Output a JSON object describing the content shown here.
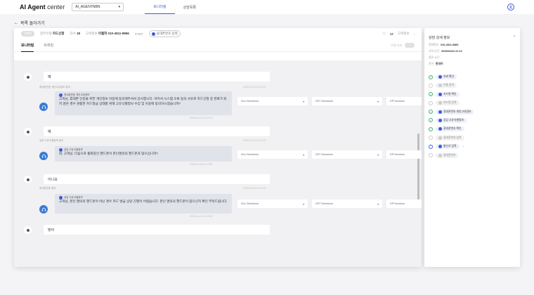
{
  "app": {
    "brand_bold": "AI Agent",
    "brand_thin": " center",
    "agent_value": "AI_AGENTNBN"
  },
  "nav": {
    "items": [
      {
        "label": "모니터링",
        "active": true
      },
      {
        "label": "상담목록",
        "active": false
      }
    ]
  },
  "back": {
    "label": "목록 돌아가기"
  },
  "info": {
    "status": "진행중",
    "type_label": "업무유형",
    "type_value": "카드신청",
    "turn_label": "차수",
    "turn_value": "18",
    "customer_label": "고객정보",
    "customer_name": "이철희",
    "customer_phone": "010-4511-9866",
    "step_label": "STEP",
    "step_value": "휴대폰번호 입력",
    "count": "17",
    "count_label": "고객정보"
  },
  "tabs": {
    "items": [
      {
        "label": "모니터링",
        "active": true
      },
      {
        "label": "트래킹",
        "active": false
      }
    ],
    "toggle_label": "모델 조회"
  },
  "dropdowns": {
    "nlu": "NLU Decisions",
    "dst": "DST Decisions",
    "dp": "DP Decision"
  },
  "messages": [
    {
      "user_text": "예",
      "user_ts": "2025-04-24 21:13:14",
      "sys_label": "휴대폰번호 개인고유정보 동의",
      "bot_tag": "휴대폰번호 개인고유정보",
      "bot_text": "고객님, 휴대폰 인증을 위한 개인정보 이용에 동의해주셔서 감사합니다. 이어서 시스템 오류 등의 사유로 카드신청 중 완료가 되지 않은 경우 원활한 카드발급 상태를 위해 고유식별정보 수집 및 이용에 동의하시겠습니까?",
      "bot_ts": "2025-04-24 21:13:14"
    },
    {
      "user_text": "예",
      "user_ts": "2025-04-24 21:13:24",
      "sys_label": "상담 고유식별정보 동의",
      "bot_tag": "상담 고유식별정보",
      "bot_text": "네, 고객님. 다음으로 통화중인 핸드폰이 본인명의의 핸드폰과 맞으십니까?",
      "bot_ts": "2025-04-24 21:13:34"
    },
    {
      "user_text": "아니요",
      "user_ts": "2025-04-24 21:13:40",
      "sys_label": "휴대폰번호 확인",
      "bot_tag": "상담 고유식별정보",
      "bot_text": "고객님, 본인 명의의 핸드폰이 아닌 경우 카드 발급 상담 진행이 어렵습니다. 본인 명의의 핸드폰이 맞으신지 확인 부탁드립니다.",
      "bot_ts": "2025-04-24 21:13:52"
    },
    {
      "user_text": "맞아"
    }
  ],
  "side": {
    "title": "상담 상세 정보",
    "phone_label": "전화번호",
    "phone_value": "010-4511-9866",
    "start_label": "시작 시간",
    "start_value": "2025/04/24 21:12",
    "end_label": "종료 시간",
    "end_value": "",
    "lang_label": "언어",
    "lang_value": "한국어",
    "steps": [
      {
        "num": "01",
        "label": "의뢰 확인",
        "done": true
      },
      {
        "num": "02",
        "label": "이름 입력",
        "done": false
      },
      {
        "num": "03",
        "label": "카드명 확인",
        "done": true
      },
      {
        "num": "04",
        "label": "카드명 입력",
        "done": false
      },
      {
        "num": "05",
        "label": "휴대폰번호 개인고유정보",
        "done": true
      },
      {
        "num": "06",
        "label": "상담 고유식별정보",
        "done": true
      },
      {
        "num": "07",
        "label": "휴대폰번호 확인",
        "done": true
      },
      {
        "num": "08",
        "label": "휴대폰번호 입력",
        "done": false
      },
      {
        "num": "09",
        "label": "통신사 입력",
        "done": false
      },
      {
        "num": "10",
        "label": "휴대폰번호",
        "done": false
      }
    ]
  }
}
